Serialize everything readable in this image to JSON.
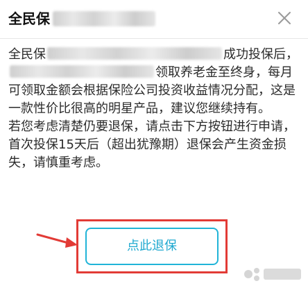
{
  "dialog": {
    "title": "全民保",
    "close_icon": "close-icon"
  },
  "content": {
    "line1_start": "全民保",
    "line1_end": "成功投保",
    "line2_start": "后，",
    "line2_end": "领取养老金至终身，每月可领取金额会根据保险公司投资收益情况分配，这是一款性价比很高的明星产品，建议您继续持有。",
    "paragraph2": "若您考虑清楚仍要退保，请点击下方按钮进行申请，首次投保15天后（超出犹豫期）退保会产生资金损失，请慎重考虑。"
  },
  "button": {
    "label": "点此退保"
  },
  "annotation": {
    "highlight_color": "#e23b36",
    "arrow_icon": "red-arrow-icon"
  },
  "colors": {
    "button_border": "#20b4d8",
    "button_text": "#20a9d0",
    "text": "#2b2b2b"
  }
}
